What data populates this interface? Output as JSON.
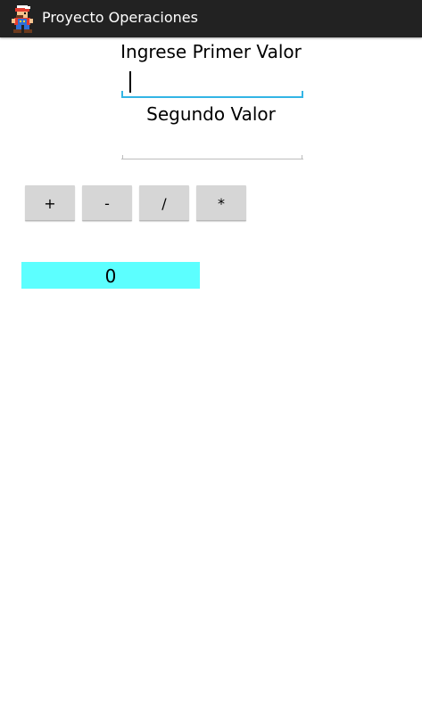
{
  "app": {
    "title": "Proyecto Operaciones",
    "icon": "mario-icon"
  },
  "form": {
    "first_label": "Ingrese Primer Valor",
    "first_value": "",
    "second_label": "Segundo Valor",
    "second_value": ""
  },
  "operations": {
    "add_label": "+",
    "subtract_label": "-",
    "divide_label": "/",
    "multiply_label": "*"
  },
  "result": {
    "value": "0",
    "background": "#5cffff"
  },
  "colors": {
    "action_bar": "#222222",
    "focus_accent": "#33b5e5",
    "button_face": "#d6d6d6"
  }
}
